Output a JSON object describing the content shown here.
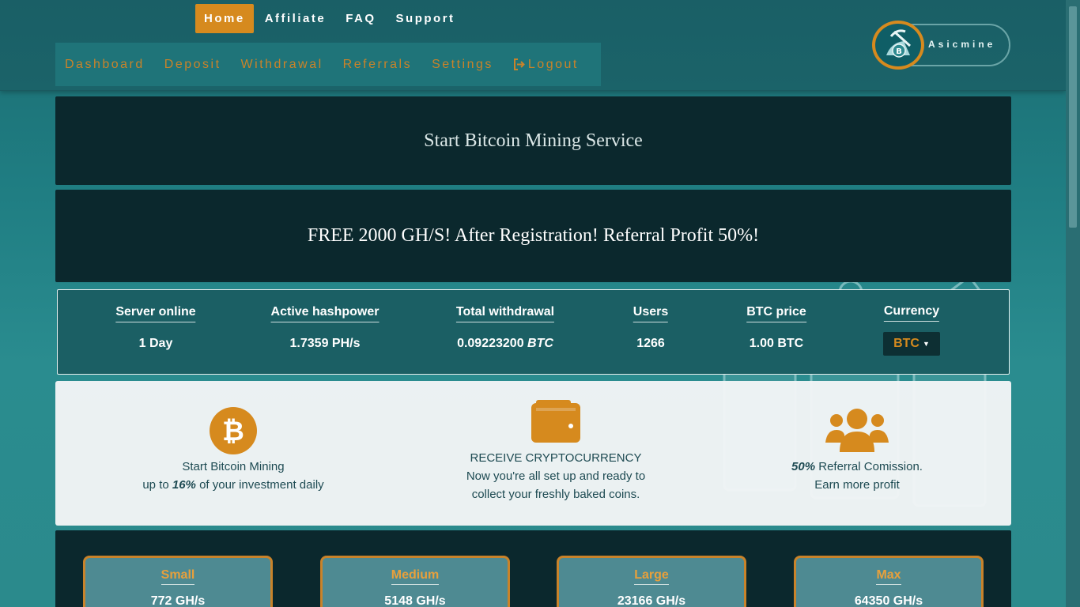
{
  "top_nav": [
    {
      "label": "Home",
      "active": true
    },
    {
      "label": "Affiliate"
    },
    {
      "label": "FAQ"
    },
    {
      "label": "Support"
    }
  ],
  "sub_nav": [
    {
      "label": "Dashboard"
    },
    {
      "label": "Deposit"
    },
    {
      "label": "Withdrawal"
    },
    {
      "label": "Referrals"
    },
    {
      "label": "Settings"
    },
    {
      "label": "Logout",
      "icon": "logout-icon"
    }
  ],
  "logo": {
    "text": "Asicmine",
    "icon": "bitcoin-miner-logo"
  },
  "banners": {
    "headline": "Start Bitcoin Mining Service",
    "promo": "FREE 2000 GH/S! After Registration! Referral Profit 50%!"
  },
  "stats": [
    {
      "label": "Server online",
      "value": "1 Day"
    },
    {
      "label": "Active hashpower",
      "value": "1.7359 PH/s"
    },
    {
      "label": "Total withdrawal",
      "value": "0.09223200",
      "unit": "BTC"
    },
    {
      "label": "Users",
      "value": "1266"
    },
    {
      "label": "BTC price",
      "value": "1.00 BTC"
    },
    {
      "label": "Currency",
      "selected": "BTC"
    }
  ],
  "features": [
    {
      "icon": "bitcoin-icon",
      "line1": "Start Bitcoin Mining",
      "line2_pre": "up to ",
      "line2_em": "16%",
      "line2_post": " of your investment daily"
    },
    {
      "icon": "wallet-icon",
      "line1": "RECEIVE CRYPTOCURRENCY",
      "line2": "Now you're all set up and ready to",
      "line3": "collect your freshly baked coins."
    },
    {
      "icon": "users-group-icon",
      "line1_em": "50%",
      "line1_post": " Referral Comission.",
      "line2": "Earn more profit"
    }
  ],
  "plans": [
    {
      "name": "Small",
      "rate": "772 GH/s"
    },
    {
      "name": "Medium",
      "rate": "5148 GH/s"
    },
    {
      "name": "Large",
      "rate": "23166 GH/s"
    },
    {
      "name": "Max",
      "rate": "64350 GH/s"
    }
  ],
  "colors": {
    "accent": "#d68a1e",
    "dark_panel": "#0b282d",
    "teal": "#1f7479"
  }
}
